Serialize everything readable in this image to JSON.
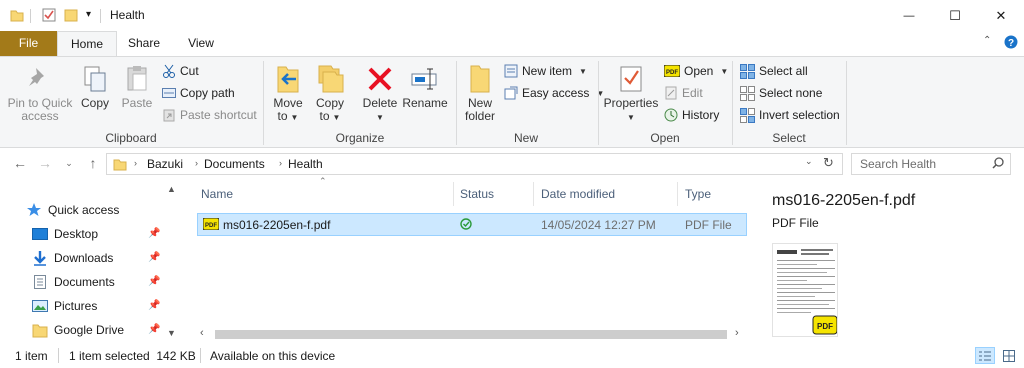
{
  "window": {
    "title": "Health",
    "minimize_glyph": "—",
    "maximize_glyph": "☐",
    "close_glyph": "✕"
  },
  "ribbon_tabs": {
    "file": "File",
    "home": "Home",
    "share": "Share",
    "view": "View"
  },
  "ribbon": {
    "clipboard": {
      "label": "Clipboard",
      "pin_line1": "Pin to Quick",
      "pin_line2": "access",
      "copy": "Copy",
      "paste": "Paste",
      "cut": "Cut",
      "copy_path": "Copy path",
      "paste_shortcut": "Paste shortcut"
    },
    "organize": {
      "label": "Organize",
      "move_line1": "Move",
      "move_line2": "to",
      "copy_line1": "Copy",
      "copy_line2": "to",
      "delete": "Delete",
      "rename": "Rename"
    },
    "new": {
      "label": "New",
      "new_folder_line1": "New",
      "new_folder_line2": "folder",
      "new_item": "New item",
      "easy_access": "Easy access"
    },
    "open": {
      "label": "Open",
      "properties": "Properties",
      "open": "Open",
      "edit": "Edit",
      "history": "History"
    },
    "select": {
      "label": "Select",
      "select_all": "Select all",
      "select_none": "Select none",
      "invert_selection": "Invert selection"
    }
  },
  "address": {
    "crumbs": [
      "Bazuki",
      "Documents",
      "Health"
    ],
    "search_placeholder": "Search Health"
  },
  "nav_pane": {
    "items": [
      {
        "label": "Quick access",
        "icon": "star-icon",
        "pinned": false
      },
      {
        "label": "Desktop",
        "icon": "desktop-icon",
        "pinned": true
      },
      {
        "label": "Downloads",
        "icon": "download-icon",
        "pinned": true
      },
      {
        "label": "Documents",
        "icon": "documents-icon",
        "pinned": true
      },
      {
        "label": "Pictures",
        "icon": "pictures-icon",
        "pinned": true
      },
      {
        "label": "Google Drive",
        "icon": "folder-icon",
        "pinned": true
      }
    ]
  },
  "file_list": {
    "columns": [
      "Name",
      "Status",
      "Date modified",
      "Type"
    ],
    "rows": [
      {
        "name": "ms016-2205en-f.pdf",
        "status": "synced",
        "date_modified": "14/05/2024 12:27 PM",
        "type": "PDF File",
        "selected": true
      }
    ]
  },
  "preview": {
    "title": "ms016-2205en-f.pdf",
    "type": "PDF File"
  },
  "status_bar": {
    "item_count": "1 item",
    "selected": "1 item selected  142 KB",
    "availability": "Available on this device"
  },
  "colors": {
    "file_tab": "#a37a19",
    "selection_bg": "#cce8ff",
    "selection_border": "#99d1ff",
    "accent_blue": "#0078d7",
    "delete_red": "#e81123",
    "folder_yellow": "#f8d775"
  }
}
